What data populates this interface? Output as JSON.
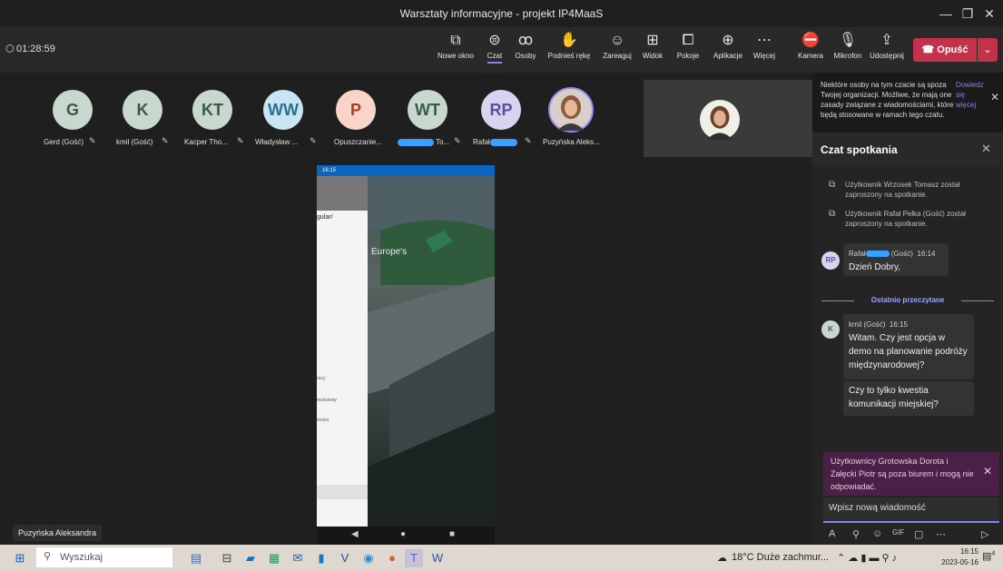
{
  "window": {
    "title": "Warsztaty informacyjne - projekt IP4MaaS"
  },
  "meeting": {
    "timer": "01:28:59",
    "toolbar": [
      {
        "icon": "new-window-icon",
        "label": "Nowe okno"
      },
      {
        "icon": "chat-icon",
        "label": "Czat"
      },
      {
        "icon": "people-icon",
        "label": "Osoby"
      },
      {
        "icon": "raise-hand-icon",
        "label": "Podnieś rękę"
      },
      {
        "icon": "react-icon",
        "label": "Zareaguj"
      },
      {
        "icon": "view-icon",
        "label": "Widok"
      },
      {
        "icon": "rooms-icon",
        "label": "Pokoje"
      },
      {
        "icon": "apps-icon",
        "label": "Aplikacje"
      },
      {
        "icon": "more-icon",
        "label": "Więcej"
      },
      {
        "icon": "camera-off-icon",
        "label": "Kamera"
      },
      {
        "icon": "mic-off-icon",
        "label": "Mikrofon"
      },
      {
        "icon": "share-icon",
        "label": "Udostępnij"
      }
    ],
    "leave_label": "Opuść"
  },
  "participants": [
    {
      "initials": "G",
      "name": "Gerd (Gość)",
      "color": "#c8d8cf",
      "text": "#3a5a48"
    },
    {
      "initials": "K",
      "name": "kmil (Gość)",
      "color": "#c8d8cf",
      "text": "#3a5a48"
    },
    {
      "initials": "KT",
      "name": "Kacper Tho...",
      "color": "#c8d8cf",
      "text": "#3a5a48"
    },
    {
      "initials": "WW",
      "name": "Władysław ...",
      "color": "#c9e4f2",
      "text": "#2d6f8f"
    },
    {
      "initials": "P",
      "name": "Opuszczanie...",
      "color": "#fad4c8",
      "text": "#a64125"
    },
    {
      "initials": "WT",
      "name": "To...",
      "color": "#c8d8cf",
      "text": "#3a5a48"
    },
    {
      "initials": "RP",
      "name": "Rafał",
      "color": "#d8d4f0",
      "text": "#5b4fa3"
    },
    {
      "initials": "",
      "name": "Puzyńska Aleks...",
      "color": "#cfa98a",
      "text": "#5a3b22"
    }
  ],
  "self_label": "Puzyńska Aleksandra",
  "shared_phone": {
    "status_time": "16:15",
    "drawer_items": [
      "gular/",
      "racy",
      "mościowy",
      "mości"
    ],
    "logo_text": "Europe's"
  },
  "chat": {
    "notice": "Niektóre osoby na tym czacie są spoza Twojej organizacji. Możliwe, że mają one zasady związane z wiadomościami, które będą stosowane w ramach tego czatu.",
    "notice_link": "Dowiedz się więcej",
    "title": "Czat spotkania",
    "system_messages": [
      "Użytkownik Wrzosek Tomasz został zaproszony na spotkanie.",
      "Użytkownik Rafał Pełka (Gość) został zaproszony na spotkanie."
    ],
    "messages": [
      {
        "initials": "RP",
        "author": "Rafał",
        "author_suffix": "(Gość)",
        "time": "16:14",
        "text": "Dzień Dobry,"
      },
      {
        "initials": "K",
        "author": "kmil (Gość)",
        "time": "16:15",
        "text": "Witam. Czy jest opcja w demo na planowanie podróży międzynarodowej?",
        "text2": "Czy to tylko kwestia komunikacji miejskiej?"
      }
    ],
    "divider": "Ostatnio przeczytane",
    "oos_banner": "Użytkownicy Grotowska Dorota i Załęcki Piotr są poza biurem i mogą nie odpowiadać.",
    "compose_placeholder": "Wpisz nową wiadomość"
  },
  "taskbar": {
    "search": "Wyszukaj",
    "weather": "18°C Duże zachmur...",
    "time": "16:15",
    "date": "2023-05-16",
    "notif_count": "4"
  }
}
